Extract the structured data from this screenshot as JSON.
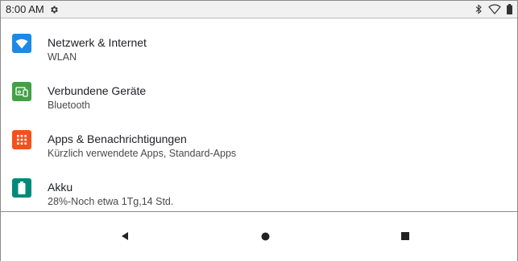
{
  "status_bar": {
    "time": "8:00 AM",
    "icons": [
      "gear-icon",
      "bluetooth-icon",
      "wifi-icon",
      "battery-icon"
    ]
  },
  "settings": {
    "items": [
      {
        "title": "Netzwerk & Internet",
        "subtitle": "WLAN",
        "icon": "wifi-icon",
        "color": "#1e88e5"
      },
      {
        "title": "Verbundene Geräte",
        "subtitle": "Bluetooth",
        "icon": "devices-icon",
        "color": "#43a047"
      },
      {
        "title": "Apps & Benachrichtigungen",
        "subtitle": "Kürzlich verwendete Apps, Standard-Apps",
        "icon": "apps-grid-icon",
        "color": "#f4511e"
      },
      {
        "title": "Akku",
        "subtitle": "28%-Noch etwa 1Tg,14 Std.",
        "icon": "battery-icon",
        "color": "#00897b"
      }
    ]
  },
  "nav_bar": {
    "buttons": [
      "back-icon",
      "home-icon",
      "recents-icon"
    ]
  }
}
